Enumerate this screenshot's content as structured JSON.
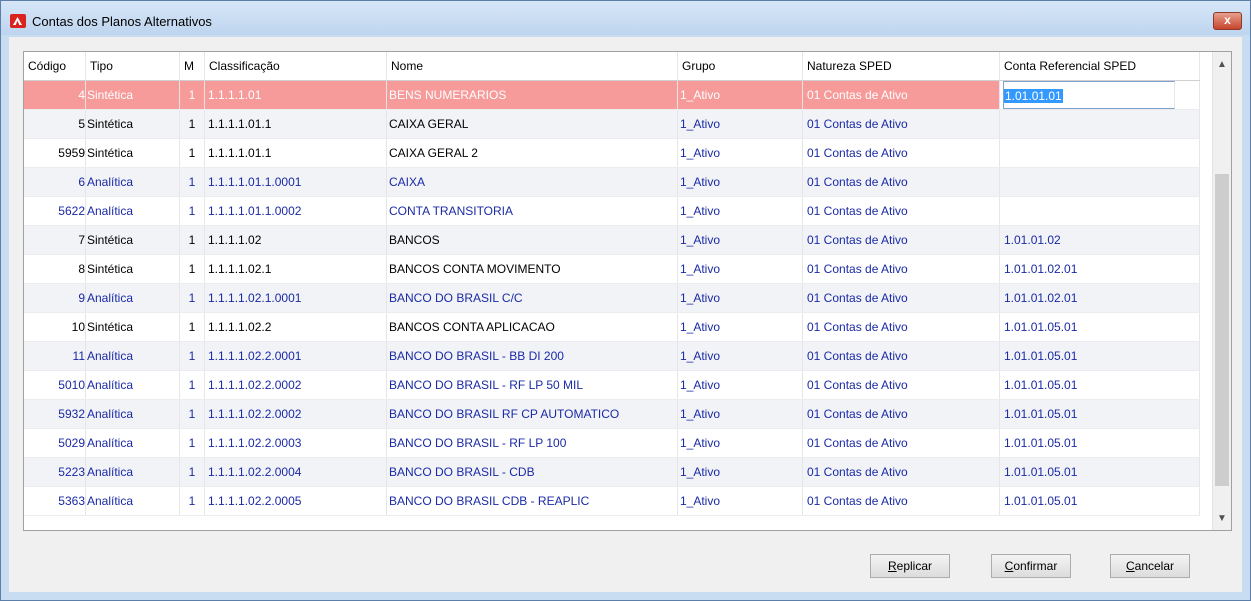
{
  "window": {
    "title": "Contas dos Planos Alternativos",
    "close_glyph": "x"
  },
  "columns": [
    "Código",
    "Tipo",
    "M",
    "Classificação",
    "Nome",
    "Grupo",
    "Natureza SPED",
    "Conta Referencial SPED"
  ],
  "rows": [
    {
      "codigo": "4",
      "tipo": "Sintética",
      "m": "1",
      "classificacao": "1.1.1.1.01",
      "nome": "BENS NUMERARIOS",
      "grupo": "1_Ativo",
      "natureza": "01 Contas de Ativo",
      "referencial": "1.01.01.01",
      "selected": true
    },
    {
      "codigo": "5",
      "tipo": "Sintética",
      "m": "1",
      "classificacao": "1.1.1.1.01.1",
      "nome": "CAIXA GERAL",
      "grupo": "1_Ativo",
      "natureza": "01 Contas de Ativo",
      "referencial": ""
    },
    {
      "codigo": "5959",
      "tipo": "Sintética",
      "m": "1",
      "classificacao": "1.1.1.1.01.1",
      "nome": "CAIXA GERAL 2",
      "grupo": "1_Ativo",
      "natureza": "01 Contas de Ativo",
      "referencial": ""
    },
    {
      "codigo": "6",
      "tipo": "Analítica",
      "m": "1",
      "classificacao": "1.1.1.1.01.1.0001",
      "nome": "CAIXA",
      "grupo": "1_Ativo",
      "natureza": "01 Contas de Ativo",
      "referencial": ""
    },
    {
      "codigo": "5622",
      "tipo": "Analítica",
      "m": "1",
      "classificacao": "1.1.1.1.01.1.0002",
      "nome": "CONTA TRANSITORIA",
      "grupo": "1_Ativo",
      "natureza": "01 Contas de Ativo",
      "referencial": ""
    },
    {
      "codigo": "7",
      "tipo": "Sintética",
      "m": "1",
      "classificacao": "1.1.1.1.02",
      "nome": "BANCOS",
      "grupo": "1_Ativo",
      "natureza": "01 Contas de Ativo",
      "referencial": "1.01.01.02"
    },
    {
      "codigo": "8",
      "tipo": "Sintética",
      "m": "1",
      "classificacao": "1.1.1.1.02.1",
      "nome": "BANCOS CONTA MOVIMENTO",
      "grupo": "1_Ativo",
      "natureza": "01 Contas de Ativo",
      "referencial": "1.01.01.02.01"
    },
    {
      "codigo": "9",
      "tipo": "Analítica",
      "m": "1",
      "classificacao": "1.1.1.1.02.1.0001",
      "nome": "BANCO DO BRASIL C/C",
      "grupo": "1_Ativo",
      "natureza": "01 Contas de Ativo",
      "referencial": "1.01.01.02.01"
    },
    {
      "codigo": "10",
      "tipo": "Sintética",
      "m": "1",
      "classificacao": "1.1.1.1.02.2",
      "nome": "BANCOS CONTA APLICACAO",
      "grupo": "1_Ativo",
      "natureza": "01 Contas de Ativo",
      "referencial": "1.01.01.05.01"
    },
    {
      "codigo": "11",
      "tipo": "Analítica",
      "m": "1",
      "classificacao": "1.1.1.1.02.2.0001",
      "nome": "BANCO DO BRASIL - BB DI 200",
      "grupo": "1_Ativo",
      "natureza": "01 Contas de Ativo",
      "referencial": "1.01.01.05.01"
    },
    {
      "codigo": "5010",
      "tipo": "Analítica",
      "m": "1",
      "classificacao": "1.1.1.1.02.2.0002",
      "nome": "BANCO DO BRASIL - RF LP 50 MIL",
      "grupo": "1_Ativo",
      "natureza": "01 Contas de Ativo",
      "referencial": "1.01.01.05.01"
    },
    {
      "codigo": "5932",
      "tipo": "Analítica",
      "m": "1",
      "classificacao": "1.1.1.1.02.2.0002",
      "nome": "BANCO DO BRASIL RF CP AUTOMATICO",
      "grupo": "1_Ativo",
      "natureza": "01 Contas de Ativo",
      "referencial": "1.01.01.05.01"
    },
    {
      "codigo": "5029",
      "tipo": "Analítica",
      "m": "1",
      "classificacao": "1.1.1.1.02.2.0003",
      "nome": "BANCO DO BRASIL - RF LP 100",
      "grupo": "1_Ativo",
      "natureza": "01 Contas de Ativo",
      "referencial": "1.01.01.05.01"
    },
    {
      "codigo": "5223",
      "tipo": "Analítica",
      "m": "1",
      "classificacao": "1.1.1.1.02.2.0004",
      "nome": "BANCO DO BRASIL - CDB",
      "grupo": "1_Ativo",
      "natureza": "01 Contas de Ativo",
      "referencial": "1.01.01.05.01"
    },
    {
      "codigo": "5363",
      "tipo": "Analítica",
      "m": "1",
      "classificacao": "1.1.1.1.02.2.0005",
      "nome": "BANCO DO BRASIL CDB - REAPLIC",
      "grupo": "1_Ativo",
      "natureza": "01 Contas de Ativo",
      "referencial": "1.01.01.05.01"
    }
  ],
  "buttons": {
    "replicar": {
      "accel": "R",
      "rest": "eplicar"
    },
    "confirmar": {
      "accel": "C",
      "rest": "onfirmar"
    },
    "cancelar": {
      "accel": "C",
      "rest": "ancelar"
    }
  },
  "colors": {
    "selected_row": "#f69a9a",
    "analitica_text": "#1a2aa6",
    "titlebar": "#bed5ef"
  }
}
